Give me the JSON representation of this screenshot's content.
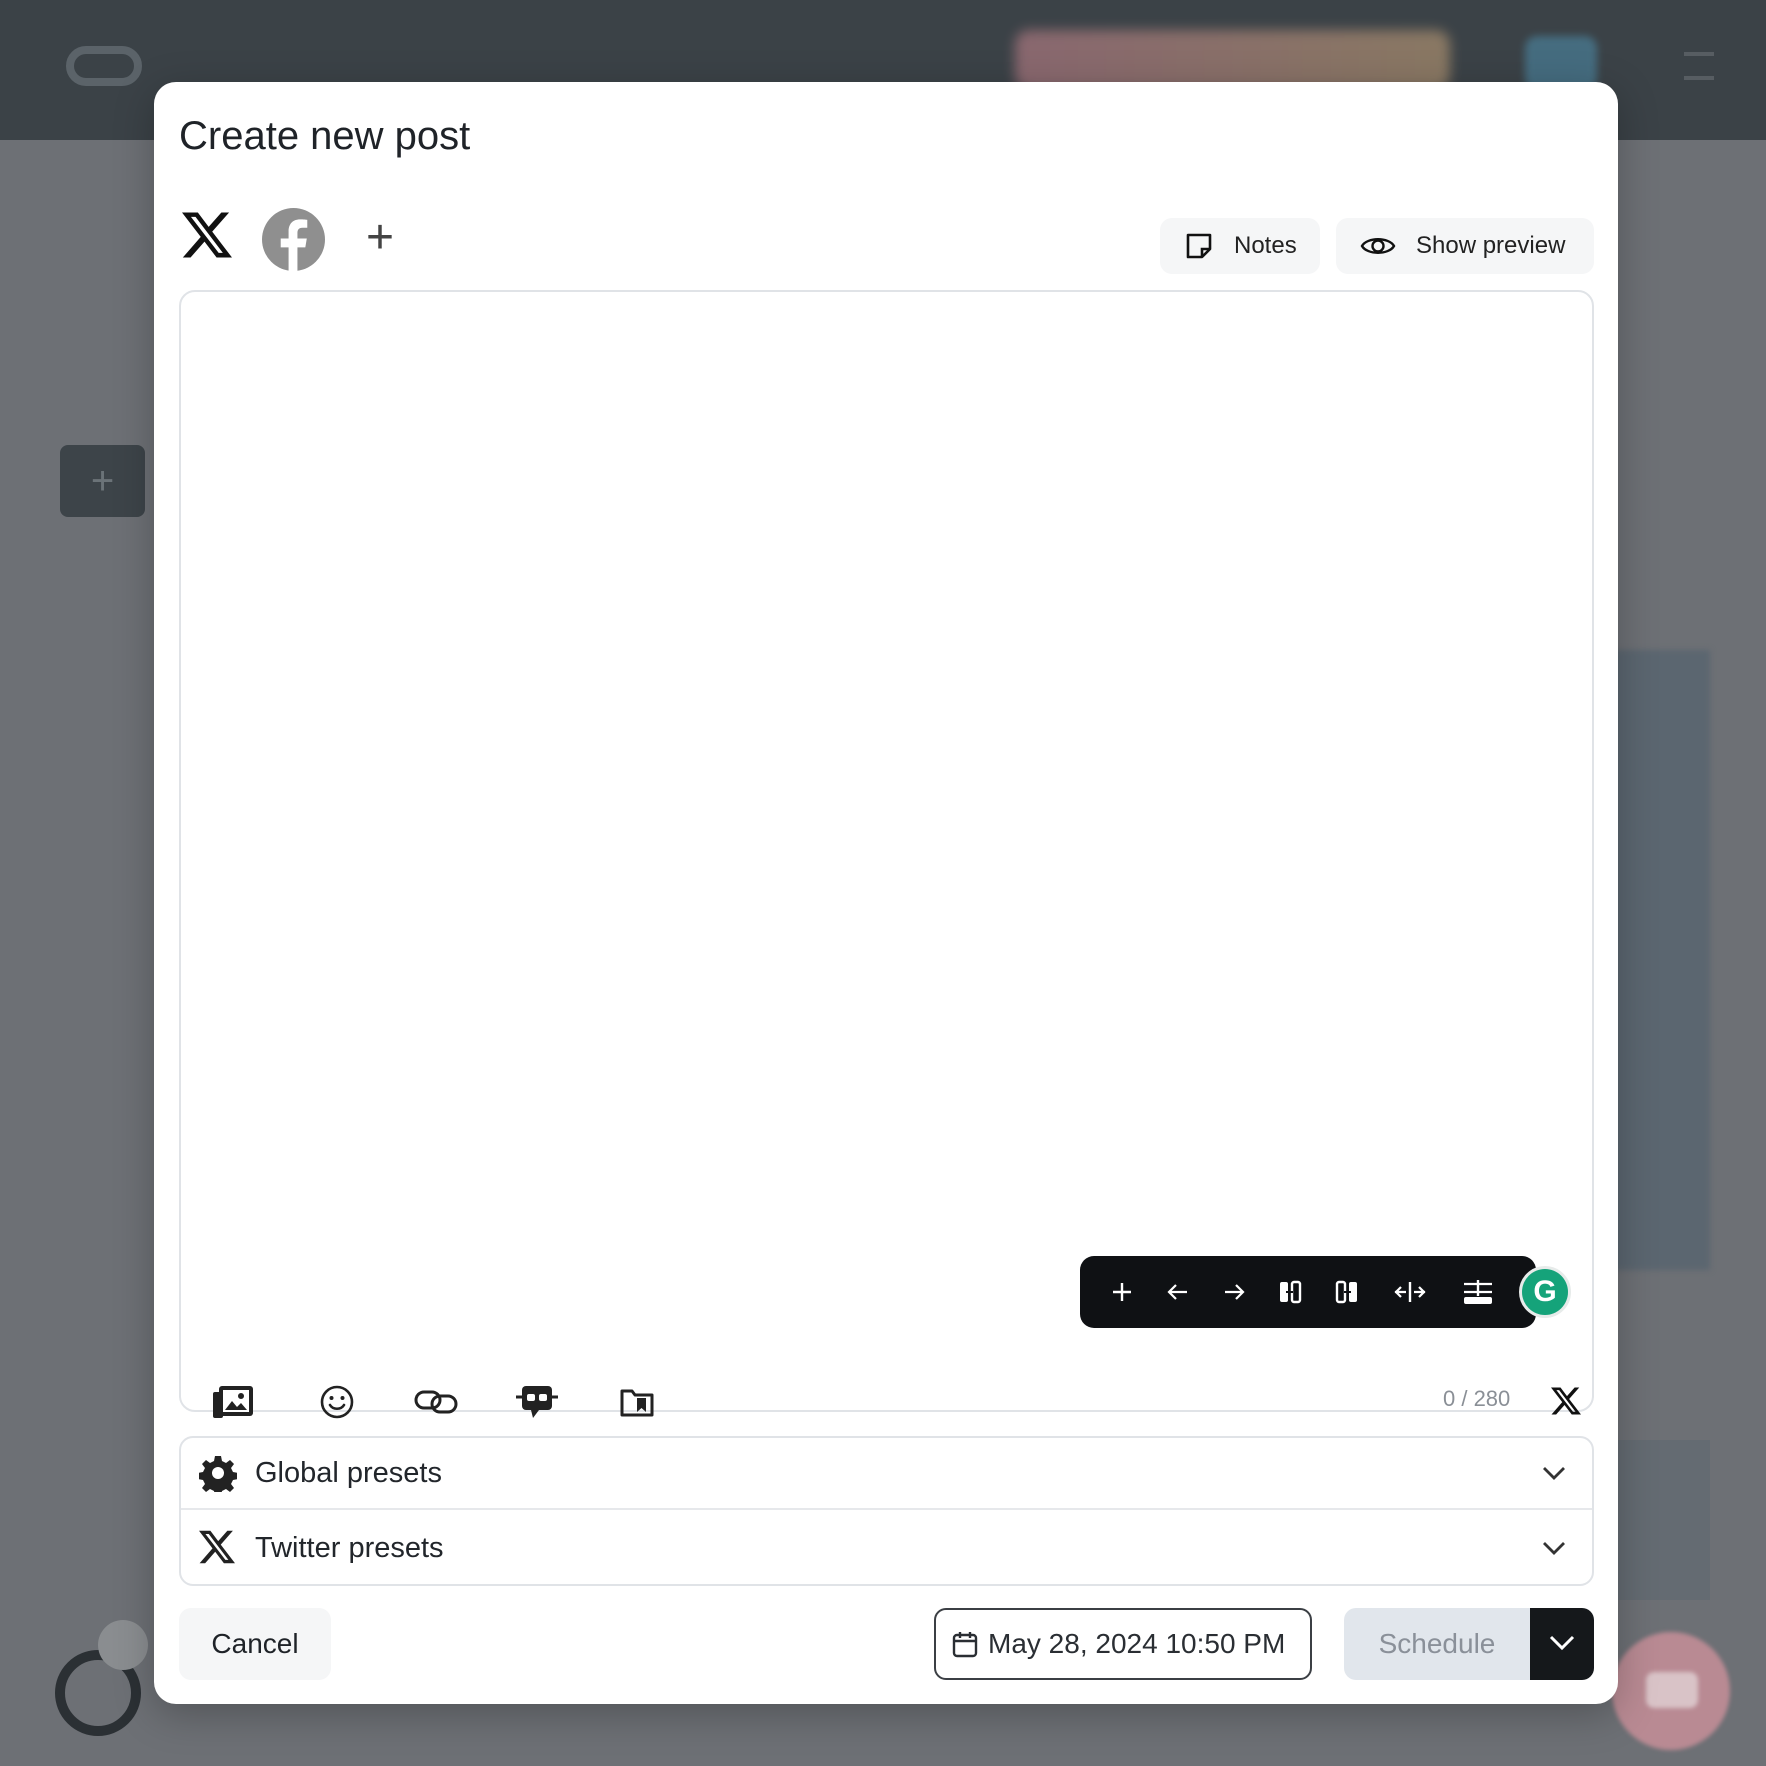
{
  "modal": {
    "title": "Create new post",
    "channels": [
      {
        "name": "X",
        "icon": "x-logo-icon"
      },
      {
        "name": "Facebook",
        "icon": "facebook-icon"
      }
    ],
    "add_channel_icon": "plus-icon",
    "notes_label": "Notes",
    "show_preview_label": "Show preview"
  },
  "editor": {
    "content": "",
    "floating_toolbar_icons": [
      "plus-icon",
      "arrow-left-icon",
      "arrow-right-icon",
      "split-left-icon",
      "split-right-icon",
      "split-horizontal-icon",
      "insert-break-icon"
    ],
    "tools": [
      "media-gallery-icon",
      "emoji-icon",
      "link-icon",
      "ai-assistant-icon",
      "saved-content-icon"
    ],
    "char_count": "0 / 280"
  },
  "presets": {
    "global_label": "Global presets",
    "twitter_label": "Twitter presets"
  },
  "footer": {
    "cancel_label": "Cancel",
    "date_value": "May 28, 2024 10:50 PM",
    "schedule_label": "Schedule"
  },
  "colors": {
    "overlay": "#6d7075",
    "modal_bg": "#ffffff",
    "toolbar_bg": "#0f1114",
    "grammarly": "#15a37a",
    "schedule_disabled_bg": "#e1e6ec"
  }
}
